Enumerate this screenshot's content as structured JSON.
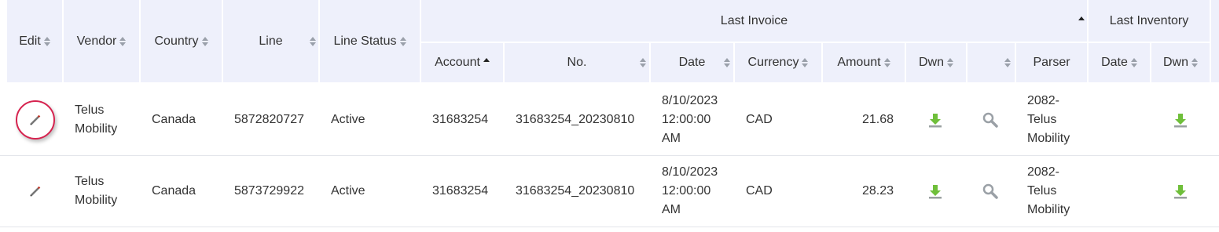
{
  "header": {
    "edit": "Edit",
    "vendor": "Vendor",
    "country": "Country",
    "line": "Line",
    "line_status": "Line Status",
    "last_invoice": "Last Invoice",
    "last_inventory": "Last Inventory",
    "account": "Account",
    "no": "No.",
    "date": "Date",
    "currency": "Currency",
    "amount": "Amount",
    "dwn": "Dwn",
    "parser": "Parser",
    "inv_date": "Date",
    "inv_dwn": "Dwn"
  },
  "sort": {
    "account": "ascending"
  },
  "rows": [
    {
      "vendor": [
        "Telus",
        "Mobility"
      ],
      "country": "Canada",
      "line": "5872820727",
      "status": "Active",
      "account": "31683254",
      "no": "31683254_20230810",
      "date": [
        "8/10/2023",
        "12:00:00",
        "AM"
      ],
      "currency": "CAD",
      "amount": "21.68",
      "parser": [
        "2082-",
        "Telus",
        "Mobility"
      ]
    },
    {
      "vendor": [
        "Telus",
        "Mobility"
      ],
      "country": "Canada",
      "line": "5873729922",
      "status": "Active",
      "account": "31683254",
      "no": "31683254_20230810",
      "date": [
        "8/10/2023",
        "12:00:00",
        "AM"
      ],
      "currency": "CAD",
      "amount": "28.23",
      "parser": [
        "2082-",
        "Telus",
        "Mobility"
      ]
    }
  ],
  "colors": {
    "header_bg": "#eef0fb",
    "download_green": "#6fbf3a",
    "highlight_ring": "#d6234f"
  },
  "icons": [
    "pencil-icon",
    "download-icon",
    "magnifier-icon",
    "sort-icon",
    "sort-ascending-icon"
  ]
}
